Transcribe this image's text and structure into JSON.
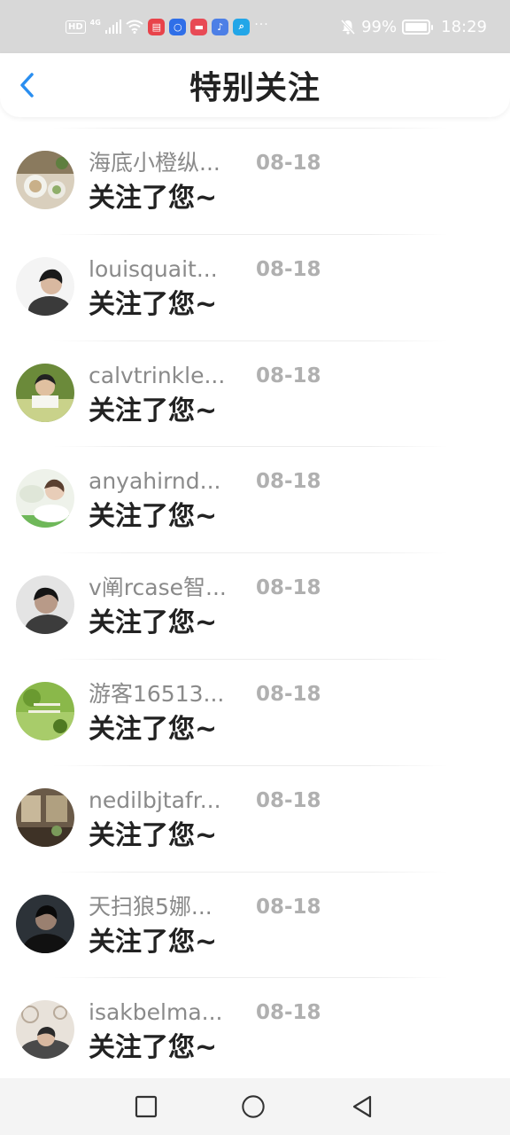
{
  "status_bar": {
    "hd": "HD",
    "network": "4G",
    "battery": "99%",
    "time": "18:29",
    "more": "···",
    "icons": [
      "signal-icon",
      "wifi-icon",
      "red-app-icon",
      "blue-bulb-app-icon",
      "red-game-app-icon",
      "music-app-icon",
      "search-app-icon",
      "mute-bell-icon",
      "battery-icon"
    ],
    "colors": {
      "red_app": "#e8434a",
      "blue_app": "#2f6fe8",
      "game_app": "#e84a55",
      "music_app": "#4d7fe6",
      "search_app": "#22a6e8"
    }
  },
  "header": {
    "title": "特别关注",
    "back_icon": "chevron-left-icon",
    "accent": "#2a8ef0"
  },
  "items": [
    {
      "name": "海底小橙纵...",
      "date": "08-18",
      "action": "关注了您~"
    },
    {
      "name": "louisquait...",
      "date": "08-18",
      "action": "关注了您~"
    },
    {
      "name": "calvtrinkle...",
      "date": "08-18",
      "action": "关注了您~"
    },
    {
      "name": "anyahirnd...",
      "date": "08-18",
      "action": "关注了您~"
    },
    {
      "name": "v阐rcase智...",
      "date": "08-18",
      "action": "关注了您~"
    },
    {
      "name": "游客16513...",
      "date": "08-18",
      "action": "关注了您~"
    },
    {
      "name": "nedilbjtafr...",
      "date": "08-18",
      "action": "关注了您~"
    },
    {
      "name": "天扫狼5娜...",
      "date": "08-18",
      "action": "关注了您~"
    },
    {
      "name": "isakbelma...",
      "date": "08-18",
      "action": "关注了您~"
    }
  ],
  "nav_bar": {
    "icons": [
      "square-recents-icon",
      "circle-home-icon",
      "triangle-back-icon"
    ]
  }
}
